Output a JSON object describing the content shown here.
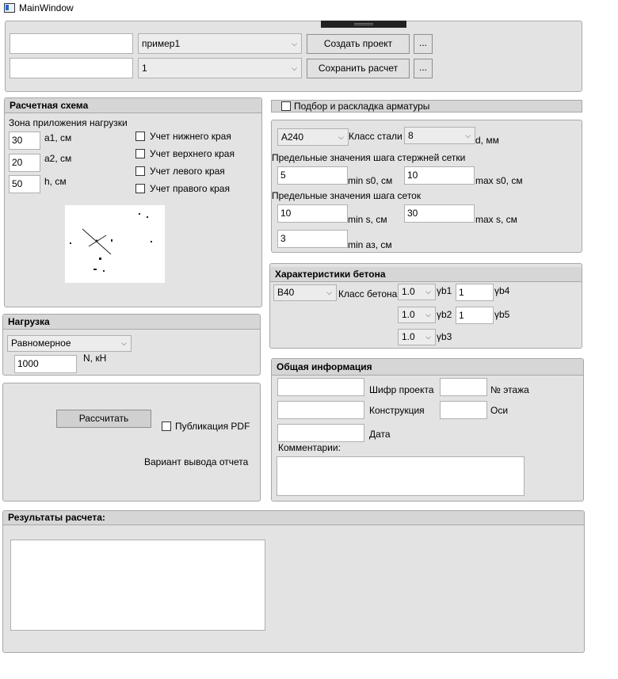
{
  "window": {
    "title": "MainWindow"
  },
  "top": {
    "input1": "",
    "combo_example": "пример1",
    "create_btn": "Создать проект",
    "dots1": "...",
    "input2": "",
    "combo_num": "1",
    "save_btn": "Сохранить расчет",
    "dots2": "..."
  },
  "scheme": {
    "header": "Расчетная схема",
    "zone_label": "Зона приложения нагрузки",
    "a1_value": "30",
    "a1_label": "a1, см",
    "a2_value": "20",
    "a2_label": "a2, см",
    "h_value": "50",
    "h_label": "h, см",
    "checks": [
      "Учет нижнего края",
      "Учет верхнего края",
      "Учет левого края",
      "Учет правого края"
    ]
  },
  "load": {
    "header": "Нагрузка",
    "type": "Равномерное",
    "n_value": "1000",
    "n_label": "N, кН"
  },
  "calc": {
    "calc_btn": "Рассчитать",
    "pdf_label": "Публикация PDF",
    "report_label": "Вариант вывода отчета"
  },
  "rebar": {
    "header_check": "Подбор и раскладка арматуры",
    "steel": "А240",
    "steel_class_label": "Класс стали",
    "diameter": "8",
    "d_label": "d, мм",
    "rod_limits_label": "Предельные значения  шага стержней сетки",
    "min_s0": "5",
    "min_s0_label": "min s0, см",
    "max_s0": "10",
    "max_s0_label": "max s0, см",
    "mesh_limits_label": "Предельные значения  шага сеток",
    "min_s": "10",
    "min_s_label": "min s, см",
    "max_s": "30",
    "max_s_label": "max s, см",
    "min_a": "3",
    "min_a_label": "min аз, см"
  },
  "concrete": {
    "header": "Характеристики бетона",
    "class": "B40",
    "class_label": "Класс бетона",
    "yb1": "1.0",
    "yb1_label": "γb1",
    "yb2": "1.0",
    "yb2_label": "γb2",
    "yb3": "1.0",
    "yb3_label": "γb3",
    "yb4": "1",
    "yb4_label": "γb4",
    "yb5": "1",
    "yb5_label": "γb5"
  },
  "info": {
    "header": "Общая информация",
    "cipher_label": "Шифр проекта",
    "floor_label": "№ этажа",
    "construction_label": "Конструкция",
    "axes_label": "Оси",
    "date_label": "Дата",
    "comments_label": "Комментарии:"
  },
  "results": {
    "header": "Результаты расчета:"
  },
  "colors": {
    "panel": "#e3e3e3",
    "header": "#d6d6d6",
    "border": "#a8a8a8"
  }
}
